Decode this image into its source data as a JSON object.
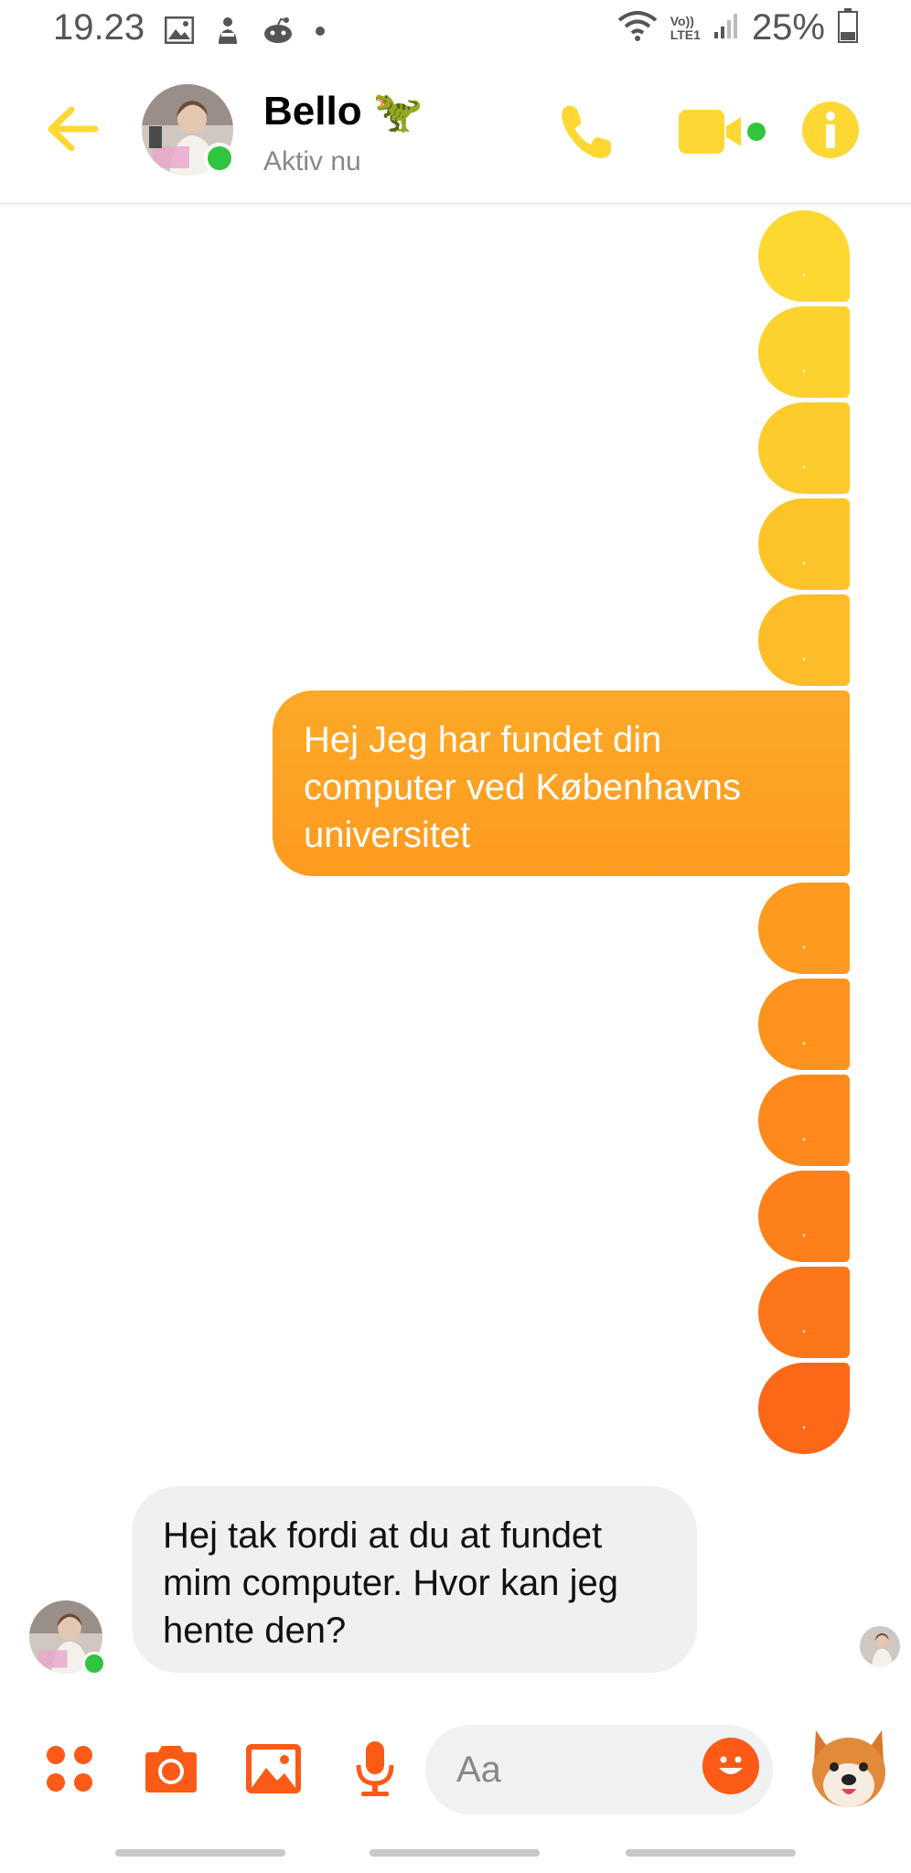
{
  "status_bar": {
    "time": "19.23",
    "battery": "25%",
    "network_label_top": "Vo))",
    "network_label_bottom": "LTE1"
  },
  "header": {
    "contact_name": "Bello",
    "contact_status": "Aktiv nu",
    "name_emoji": "🦖"
  },
  "messages": {
    "dot_text": ".",
    "sent_text": "Hej Jeg har fundet din computer ved Københavns universitet",
    "received_text": "Hej tak fordi at du at fundet mim computer. Hvor kan jeg hente den?"
  },
  "composer": {
    "placeholder": "Aa"
  },
  "colors": {
    "accent_yellow": "#fdd835",
    "accent_orange": "#fc5a17",
    "online_green": "#31c43e"
  }
}
